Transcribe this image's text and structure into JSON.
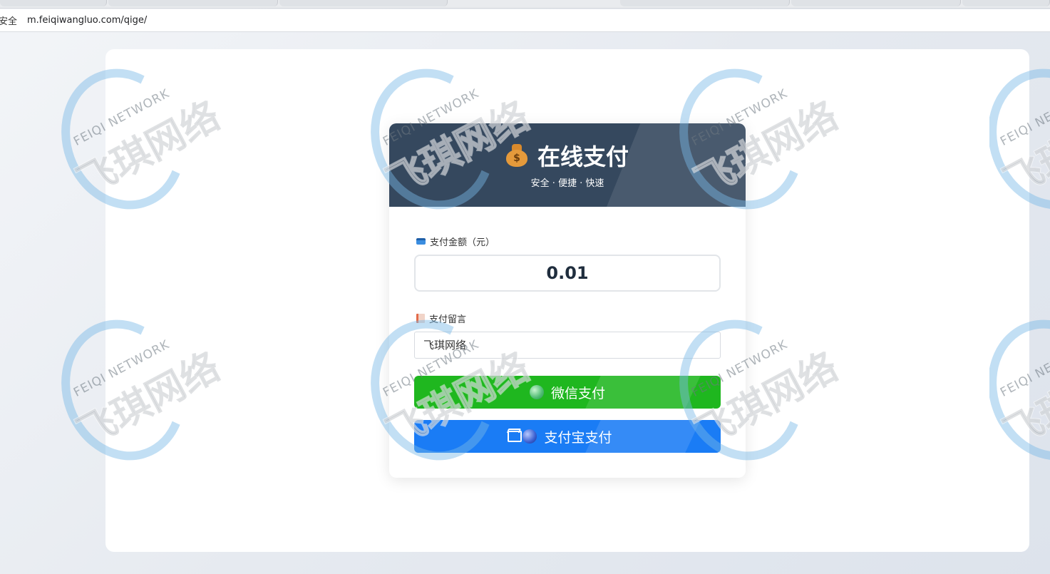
{
  "browser": {
    "security_label": "安全",
    "url": "m.feiqiwangluo.com/qige/"
  },
  "watermark": {
    "text_en": "FEIQI NETWORK",
    "text_cn": "飞琪网络"
  },
  "header": {
    "title": "在线支付",
    "subtitle": "安全 · 便捷 · 快速",
    "icon": "money-bag-icon"
  },
  "amount": {
    "label": "支付金额（元）",
    "value": "0.01",
    "icon": "credit-card-icon"
  },
  "memo": {
    "label": "支付留言",
    "value": "飞琪网络",
    "icon": "memo-icon"
  },
  "buttons": {
    "wechat_label": "微信支付",
    "alipay_label": "支付宝支付"
  },
  "colors": {
    "header_bg": "#35485e",
    "wechat": "#1fb71f",
    "alipay": "#1a7cf5"
  }
}
